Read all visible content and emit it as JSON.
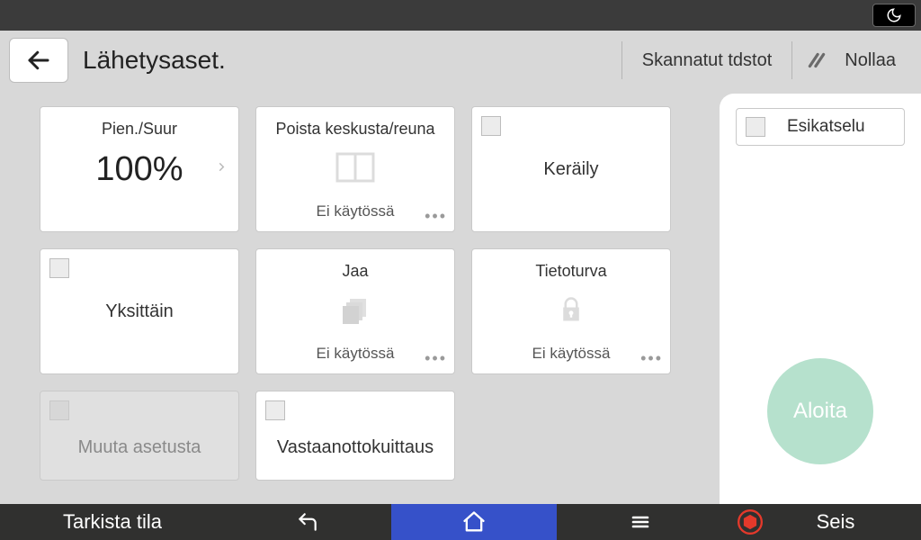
{
  "header": {
    "title": "Lähetysaset.",
    "scanned_link": "Skannatut tdstot",
    "reset_label": "Nollaa"
  },
  "tiles": {
    "reduce_enlarge": {
      "label": "Pien./Suur",
      "value": "100%"
    },
    "erase": {
      "label": "Poista keskusta/reuna",
      "status": "Ei käytössä"
    },
    "collate": {
      "label": "Keräily"
    },
    "single": {
      "label": "Yksittäin"
    },
    "divide": {
      "label": "Jaa",
      "status": "Ei käytössä"
    },
    "security": {
      "label": "Tietoturva",
      "status": "Ei käytössä"
    },
    "other": {
      "label": "Muuta asetusta"
    },
    "receipt": {
      "label": "Vastaanottokuittaus"
    }
  },
  "side": {
    "preview": "Esikatselu",
    "start": "Aloita"
  },
  "bottom": {
    "status": "Tarkista tila",
    "stop": "Seis"
  }
}
